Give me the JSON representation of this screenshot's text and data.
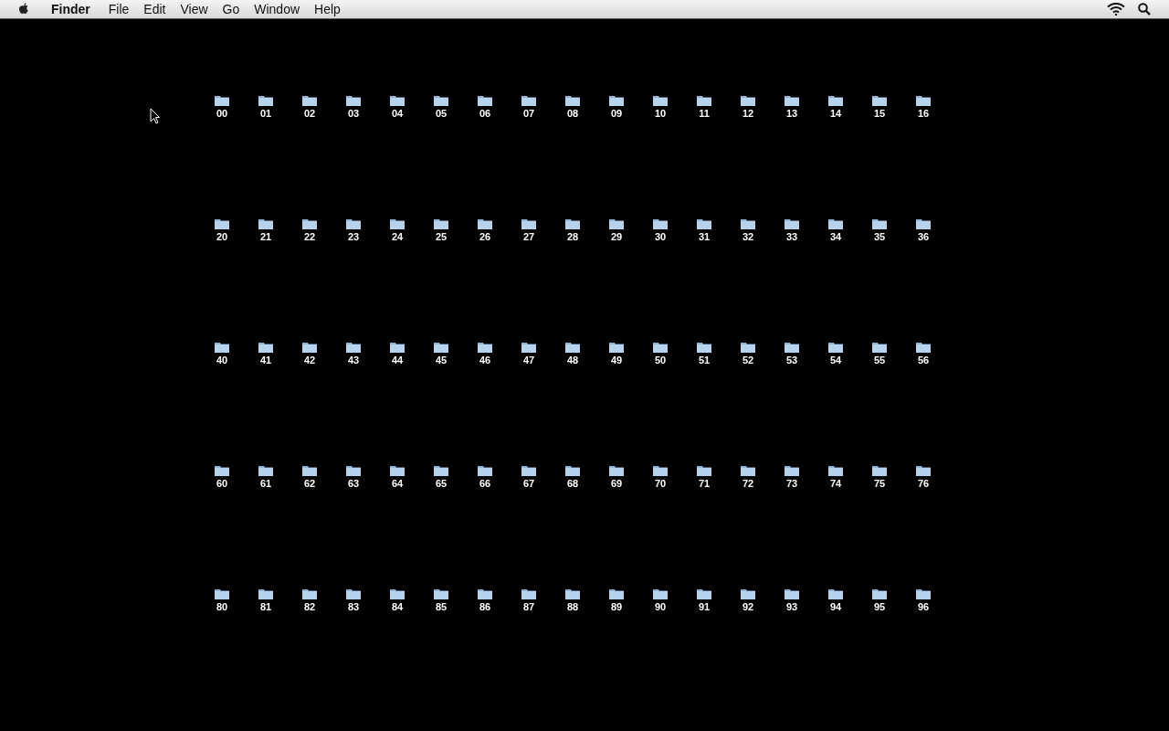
{
  "menu_bar": {
    "items": [
      {
        "label": "Finder",
        "kind": "app"
      },
      {
        "label": "File",
        "kind": "menu"
      },
      {
        "label": "Edit",
        "kind": "menu"
      },
      {
        "label": "View",
        "kind": "menu"
      },
      {
        "label": "Go",
        "kind": "menu"
      },
      {
        "label": "Window",
        "kind": "menu"
      },
      {
        "label": "Help",
        "kind": "menu"
      }
    ]
  },
  "desktop": {
    "rows": [
      {
        "icons": [
          "00",
          "01",
          "02",
          "03",
          "04",
          "05",
          "06",
          "07",
          "08",
          "09",
          "10",
          "11",
          "12",
          "13",
          "14",
          "15",
          "16"
        ]
      },
      {
        "icons": [
          "20",
          "21",
          "22",
          "23",
          "24",
          "25",
          "26",
          "27",
          "28",
          "29",
          "30",
          "31",
          "32",
          "33",
          "34",
          "35",
          "36"
        ]
      },
      {
        "icons": [
          "40",
          "41",
          "42",
          "43",
          "44",
          "45",
          "46",
          "47",
          "48",
          "49",
          "50",
          "51",
          "52",
          "53",
          "54",
          "55",
          "56"
        ]
      },
      {
        "icons": [
          "60",
          "61",
          "62",
          "63",
          "64",
          "65",
          "66",
          "67",
          "68",
          "69",
          "70",
          "71",
          "72",
          "73",
          "74",
          "75",
          "76"
        ]
      },
      {
        "icons": [
          "80",
          "81",
          "82",
          "83",
          "84",
          "85",
          "86",
          "87",
          "88",
          "89",
          "90",
          "91",
          "92",
          "93",
          "94",
          "95",
          "96"
        ]
      }
    ]
  }
}
